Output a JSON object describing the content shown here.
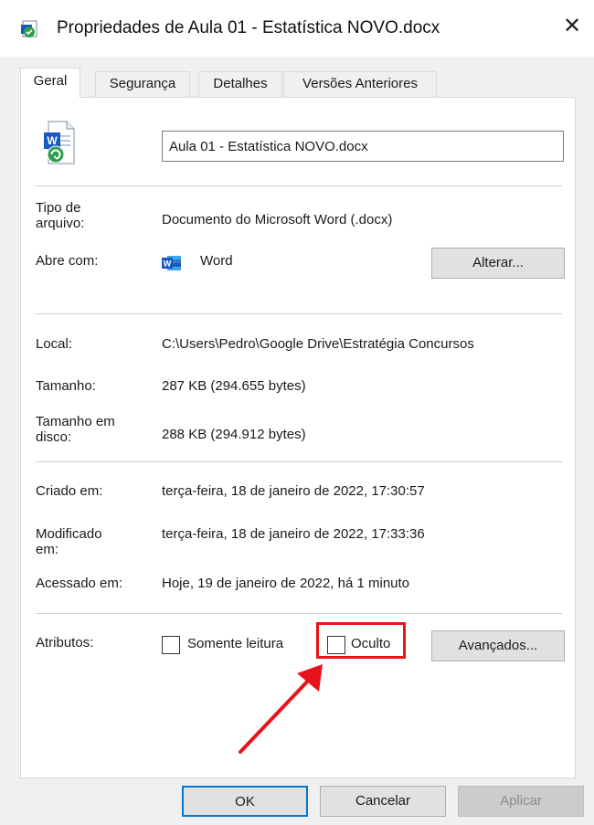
{
  "window": {
    "title": "Propriedades de Aula 01 - Estatística NOVO.docx",
    "close_glyph": "✕"
  },
  "tabs": [
    {
      "label": "Geral",
      "active": true
    },
    {
      "label": "Segurança",
      "active": false
    },
    {
      "label": "Detalhes",
      "active": false
    },
    {
      "label": "Versões Anteriores",
      "active": false
    }
  ],
  "file": {
    "name": "Aula 01 - Estatística NOVO.docx",
    "icon": "word-document-icon"
  },
  "details": {
    "type_label_1": "Tipo de",
    "type_label_2": "arquivo:",
    "type_value": "Documento do Microsoft Word (.docx)",
    "opens_with_label": "Abre com:",
    "opens_with_value": "Word",
    "change_button": "Alterar...",
    "location_label": "Local:",
    "location_value": "C:\\Users\\Pedro\\Google Drive\\Estratégia Concursos",
    "size_label": "Tamanho:",
    "size_value": "287 KB (294.655 bytes)",
    "disk_size_label_1": "Tamanho em",
    "disk_size_label_2": "disco:",
    "disk_size_value": "288 KB (294.912 bytes)",
    "created_label": "Criado em:",
    "created_value": "terça-feira, 18 de janeiro de 2022, 17:30:57",
    "modified_label_1": "Modificado",
    "modified_label_2": "em:",
    "modified_value": "terça-feira, 18 de janeiro de 2022, 17:33:36",
    "accessed_label": "Acessado em:",
    "accessed_value": "Hoje, 19 de janeiro de 2022, há 1 minuto"
  },
  "attributes": {
    "label": "Atributos:",
    "readonly_label": "Somente leitura",
    "readonly_checked": false,
    "hidden_label": "Oculto",
    "hidden_checked": false,
    "advanced_button": "Avançados..."
  },
  "footer": {
    "ok": "OK",
    "cancel": "Cancelar",
    "apply": "Aplicar"
  },
  "colors": {
    "highlight": "#e8131b",
    "word_blue": "#185abd"
  }
}
